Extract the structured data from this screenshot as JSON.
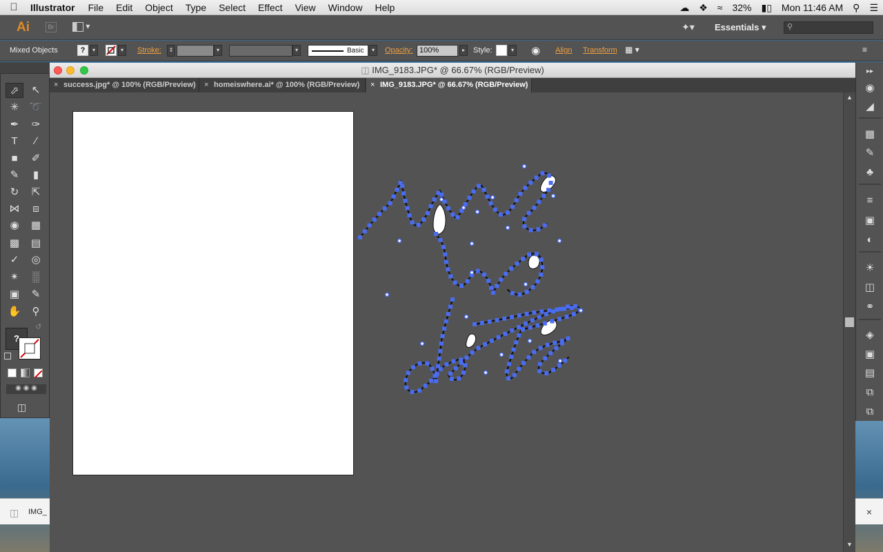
{
  "menubar": {
    "app_name": "Illustrator",
    "items": [
      "File",
      "Edit",
      "Object",
      "Type",
      "Select",
      "Effect",
      "View",
      "Window",
      "Help"
    ],
    "battery": "32%",
    "clock": "Mon 11:46 AM"
  },
  "appbar": {
    "logo": "Ai",
    "bridge_label": "Br",
    "workspace": "Essentials",
    "search_placeholder": ""
  },
  "control_bar": {
    "selection_label": "Mixed Objects",
    "fill_unknown": "?",
    "stroke_label": "Stroke:",
    "brush_label": "Basic",
    "opacity_label": "Opacity:",
    "opacity_value": "100%",
    "style_label": "Style:",
    "align_label": "Align",
    "transform_label": "Transform"
  },
  "tools_panel": {
    "fill_unknown": "?"
  },
  "document": {
    "window_title": "IMG_9183.JPG* @ 66.67% (RGB/Preview)",
    "tabs": [
      {
        "label": "success.jpg* @ 100% (RGB/Preview)",
        "active": false
      },
      {
        "label": "homeiswhere.ai* @ 100% (RGB/Preview)",
        "active": false
      },
      {
        "label": "IMG_9183.JPG* @ 66.67% (RGB/Preview)",
        "active": true
      }
    ]
  },
  "download_bar": {
    "file_label": "IMG_"
  },
  "colors": {
    "anchor_blue": "#4a6cf0",
    "ui_gray": "#535353",
    "accent_orange": "#f0a040"
  }
}
